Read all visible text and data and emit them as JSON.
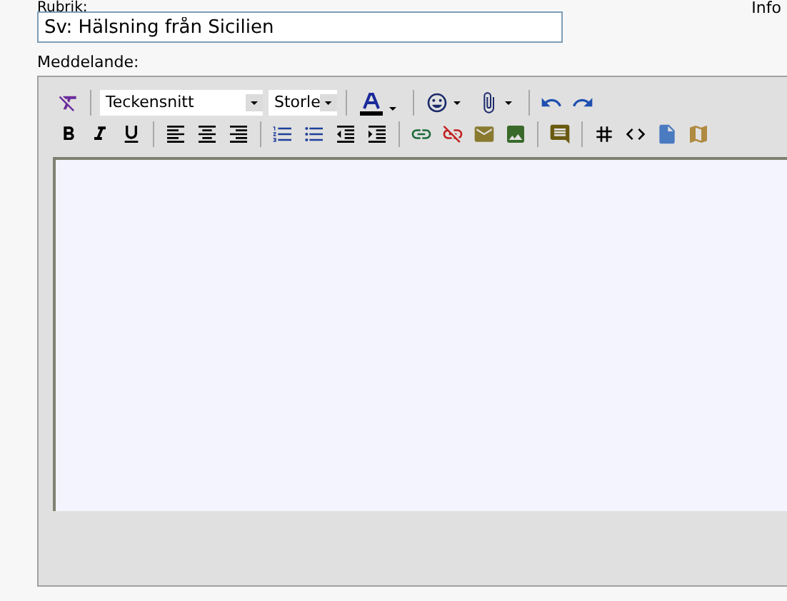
{
  "subject": {
    "label": "Rubrik:",
    "value": "Sv: Hälsning från Sicilien"
  },
  "side_label": "Info",
  "message_label": "Meddelande:",
  "toolbar_rows": [
    [
      {
        "kind": "clear-format"
      },
      {
        "kind": "separator"
      },
      {
        "kind": "font-select",
        "value": "Teckensnitt"
      },
      {
        "kind": "size-select",
        "value": "Storle"
      },
      {
        "kind": "separator"
      },
      {
        "kind": "text-color"
      },
      {
        "kind": "separator"
      },
      {
        "kind": "smiley"
      },
      {
        "kind": "attach"
      },
      {
        "kind": "separator"
      },
      {
        "kind": "undo"
      },
      {
        "kind": "redo"
      }
    ],
    [
      {
        "kind": "bold"
      },
      {
        "kind": "italic"
      },
      {
        "kind": "underline"
      },
      {
        "kind": "separator"
      },
      {
        "kind": "align-left"
      },
      {
        "kind": "align-center"
      },
      {
        "kind": "align-right"
      },
      {
        "kind": "separator"
      },
      {
        "kind": "numbered-list"
      },
      {
        "kind": "bullet-list"
      },
      {
        "kind": "outdent"
      },
      {
        "kind": "indent"
      },
      {
        "kind": "separator"
      },
      {
        "kind": "link"
      },
      {
        "kind": "unlink"
      },
      {
        "kind": "mail"
      },
      {
        "kind": "image"
      },
      {
        "kind": "separator"
      },
      {
        "kind": "comment"
      },
      {
        "kind": "separator"
      },
      {
        "kind": "hash"
      },
      {
        "kind": "code"
      },
      {
        "kind": "file"
      },
      {
        "kind": "map"
      }
    ]
  ]
}
